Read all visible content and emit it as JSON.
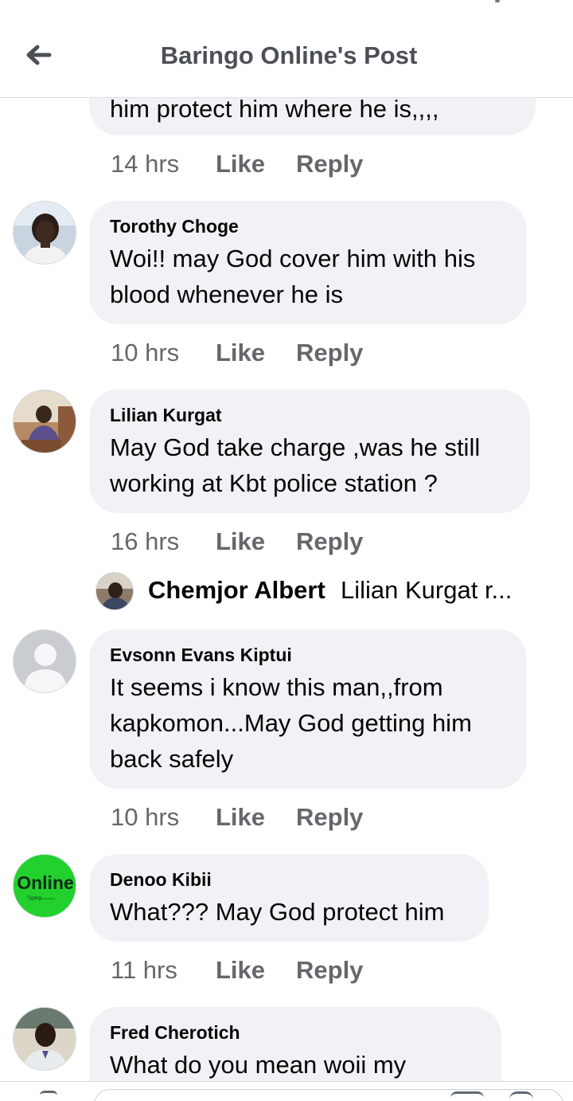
{
  "header": {
    "title": "Baringo Online's Post"
  },
  "comments": [
    {
      "text": "him protect him  where he is,,,,",
      "time": "14 hrs",
      "like": "Like",
      "reply": "Reply"
    },
    {
      "name": "Torothy Choge",
      "text": "Woi!! may God cover him with his\nblood whenever he is",
      "time": "10 hrs",
      "like": "Like",
      "reply": "Reply"
    },
    {
      "name": "Lilian Kurgat",
      "text": "May God take charge ,was he still\nworking at Kbt police station ?",
      "time": "16 hrs",
      "like": "Like",
      "reply": "Reply"
    },
    {
      "name": "Evsonn Evans Kiptui",
      "text": "It seems i know this man,,from\nkapkomon...May God getting him\nback safely",
      "time": "10 hrs",
      "like": "Like",
      "reply": "Reply"
    },
    {
      "name": "Denoo Kibii",
      "avatar_text": "Online",
      "avatar_subtext": "Typing",
      "text": "What??? May God protect him",
      "time": "11 hrs",
      "like": "Like",
      "reply": "Reply"
    },
    {
      "name": "Fred Cherotich",
      "text": "What do you mean woii my"
    }
  ],
  "reply_preview": {
    "name": "Chemjor Albert",
    "text": "Lilian Kurgat r..."
  },
  "colors": {
    "bubble": "#f0f2f5",
    "meta": "#65676b",
    "online_avatar": "#22d12e"
  }
}
